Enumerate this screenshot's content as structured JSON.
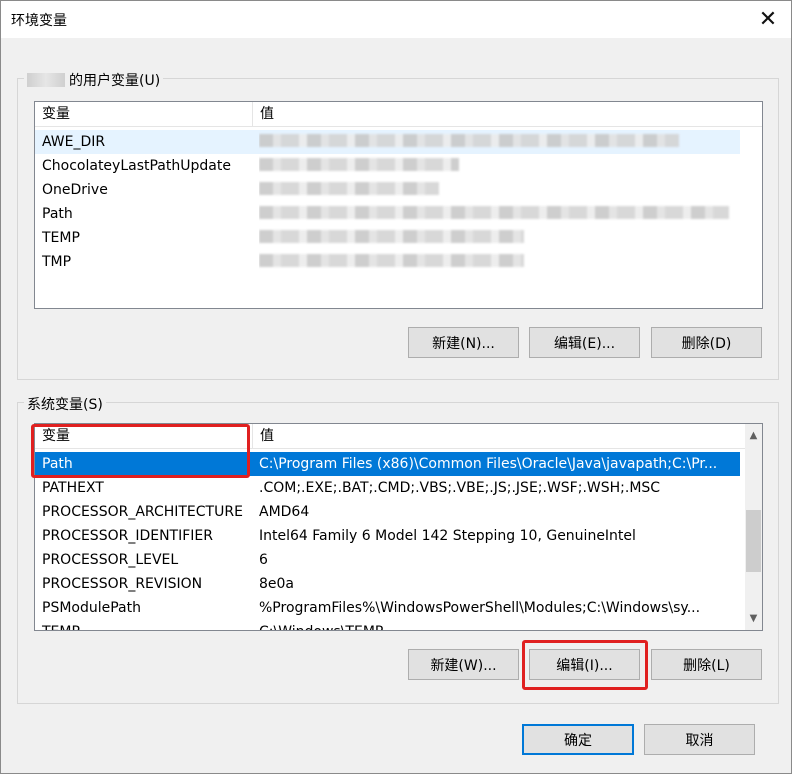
{
  "window": {
    "title": "环境变量",
    "close_glyph": "✕"
  },
  "user_group": {
    "label": "的用户变量(U)",
    "columns": [
      "变量",
      "值"
    ],
    "rows": [
      {
        "name": "AWE_DIR",
        "value": ""
      },
      {
        "name": "ChocolateyLastPathUpdate",
        "value": ""
      },
      {
        "name": "OneDrive",
        "value": ""
      },
      {
        "name": "Path",
        "value": ""
      },
      {
        "name": "TEMP",
        "value": ""
      },
      {
        "name": "TMP",
        "value": ""
      }
    ],
    "buttons": {
      "new": "新建(N)...",
      "edit": "编辑(E)...",
      "delete": "删除(D)"
    }
  },
  "system_group": {
    "label": "系统变量(S)",
    "columns": [
      "变量",
      "值"
    ],
    "rows": [
      {
        "name": "Path",
        "value": "C:\\Program Files (x86)\\Common Files\\Oracle\\Java\\javapath;C:\\Pr..."
      },
      {
        "name": "PATHEXT",
        "value": ".COM;.EXE;.BAT;.CMD;.VBS;.VBE;.JS;.JSE;.WSF;.WSH;.MSC"
      },
      {
        "name": "PROCESSOR_ARCHITECTURE",
        "value": "AMD64"
      },
      {
        "name": "PROCESSOR_IDENTIFIER",
        "value": "Intel64 Family 6 Model 142 Stepping 10, GenuineIntel"
      },
      {
        "name": "PROCESSOR_LEVEL",
        "value": "6"
      },
      {
        "name": "PROCESSOR_REVISION",
        "value": "8e0a"
      },
      {
        "name": "PSModulePath",
        "value": "%ProgramFiles%\\WindowsPowerShell\\Modules;C:\\Windows\\sy..."
      },
      {
        "name": "TEMP",
        "value": "C:\\Windows\\TEMP"
      }
    ],
    "buttons": {
      "new": "新建(W)...",
      "edit": "编辑(I)...",
      "delete": "删除(L)"
    }
  },
  "footer": {
    "ok": "确定",
    "cancel": "取消"
  },
  "colors": {
    "selection": "#0078d7",
    "annotation": "#e02020",
    "default_button_border": "#0078d7"
  }
}
